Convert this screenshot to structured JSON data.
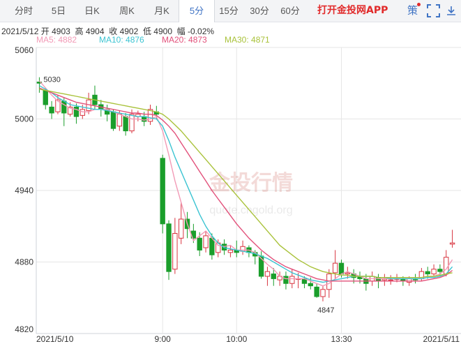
{
  "toolbar": {
    "tabs": [
      "分时",
      "5日",
      "日K",
      "周K",
      "月K",
      "5分",
      "15分",
      "30分",
      "60分"
    ],
    "active_tab": "5分",
    "app_label": "打开金投网APP",
    "extra_label": "策"
  },
  "info_bar": {
    "date": "2021/5/12",
    "open_label": "开",
    "open": "4903",
    "high_label": "高",
    "high": "4904",
    "close_label": "收",
    "close": "4902",
    "low_label": "低",
    "low": "4900",
    "change_label": "幅",
    "change": "-0.02%"
  },
  "legend": [
    {
      "label": "MA5: 4882",
      "color": "#f29ab6"
    },
    {
      "label": "MA10: 4876",
      "color": "#3cc4d2"
    },
    {
      "label": "MA20: 4873",
      "color": "#e2507a"
    },
    {
      "label": "MA30: 4871",
      "color": "#a9c23a"
    }
  ],
  "watermark": {
    "brand": "金投行情",
    "url": "quote.cngold.org"
  },
  "colors": {
    "up": "#d8343f",
    "down": "#1a9e2b",
    "grid": "#e6e6e6",
    "axis_text": "#333333"
  },
  "chart_data": {
    "type": "candlestick",
    "ylim": [
      4820,
      5060
    ],
    "yticks": [
      5060,
      5000,
      4940,
      4880,
      4820
    ],
    "xticks": [
      {
        "label": "2021/5/10",
        "index": 0
      },
      {
        "label": "9:00",
        "index": 20
      },
      {
        "label": "10:00",
        "index": 32
      },
      {
        "label": "13:30",
        "index": 49
      },
      {
        "label": "2021/5/11",
        "index": 67
      }
    ],
    "annotations": [
      {
        "text": "5030",
        "index": 0,
        "value": 5030
      },
      {
        "text": "4847",
        "index": 46,
        "value": 4847
      }
    ],
    "candles": [
      [
        5031,
        5030,
        5035,
        5022
      ],
      [
        5024,
        5012,
        5026,
        5008
      ],
      [
        5010,
        5005,
        5015,
        5000
      ],
      [
        5006,
        5016,
        5020,
        5004
      ],
      [
        5015,
        5005,
        5018,
        4994
      ],
      [
        5004,
        5010,
        5014,
        5002
      ],
      [
        5010,
        5002,
        5013,
        4996
      ],
      [
        5003,
        5008,
        5012,
        5000
      ],
      [
        5007,
        5016,
        5022,
        5004
      ],
      [
        5020,
        5012,
        5028,
        5008
      ],
      [
        5012,
        5008,
        5016,
        5002
      ],
      [
        5008,
        5004,
        5012,
        4998
      ],
      [
        5006,
        4992,
        5008,
        4990
      ],
      [
        4994,
        5004,
        5007,
        4990
      ],
      [
        5002,
        4990,
        5005,
        4986
      ],
      [
        4990,
        5004,
        5008,
        4988
      ],
      [
        5002,
        5004,
        5007,
        4998
      ],
      [
        5002,
        4998,
        5006,
        4994
      ],
      [
        4998,
        5008,
        5012,
        4995
      ],
      [
        5006,
        5004,
        5011,
        5000
      ],
      [
        4967,
        4912,
        4970,
        4904
      ],
      [
        4912,
        4872,
        4915,
        4865
      ],
      [
        4874,
        4904,
        4917,
        4870
      ],
      [
        4900,
        4916,
        4930,
        4895
      ],
      [
        4916,
        4908,
        4922,
        4900
      ],
      [
        4906,
        4900,
        4912,
        4896
      ],
      [
        4900,
        4890,
        4905,
        4885
      ],
      [
        4892,
        4902,
        4906,
        4888
      ],
      [
        4900,
        4886,
        4904,
        4882
      ],
      [
        4888,
        4896,
        4899,
        4884
      ],
      [
        4895,
        4890,
        4899,
        4886
      ],
      [
        4888,
        4890,
        4894,
        4884
      ],
      [
        4890,
        4888,
        4898,
        4884
      ],
      [
        4889,
        4893,
        4898,
        4886
      ],
      [
        4892,
        4888,
        4894,
        4884
      ],
      [
        4888,
        4885,
        4890,
        4878
      ],
      [
        4885,
        4868,
        4889,
        4866
      ],
      [
        4868,
        4872,
        4876,
        4860
      ],
      [
        4870,
        4866,
        4875,
        4860
      ],
      [
        4865,
        4868,
        4872,
        4860
      ],
      [
        4868,
        4862,
        4872,
        4857
      ],
      [
        4862,
        4868,
        4874,
        4858
      ],
      [
        4866,
        4866,
        4871,
        4858
      ],
      [
        4866,
        4862,
        4868,
        4858
      ],
      [
        4862,
        4860,
        4867,
        4857
      ],
      [
        4859,
        4851,
        4862,
        4850
      ],
      [
        4851,
        4857,
        4860,
        4847
      ],
      [
        4857,
        4870,
        4874,
        4850
      ],
      [
        4871,
        4879,
        4890,
        4866
      ],
      [
        4879,
        4870,
        4882,
        4867
      ],
      [
        4870,
        4871,
        4876,
        4866
      ],
      [
        4870,
        4867,
        4874,
        4862
      ],
      [
        4868,
        4866,
        4872,
        4862
      ],
      [
        4866,
        4862,
        4870,
        4856
      ],
      [
        4864,
        4868,
        4872,
        4860
      ],
      [
        4867,
        4864,
        4870,
        4858
      ],
      [
        4865,
        4866,
        4870,
        4860
      ],
      [
        4865,
        4865,
        4869,
        4861
      ],
      [
        4866,
        4866,
        4870,
        4863
      ],
      [
        4866,
        4864,
        4868,
        4860
      ],
      [
        4863,
        4866,
        4868,
        4860
      ],
      [
        4866,
        4865,
        4870,
        4862
      ],
      [
        4866,
        4872,
        4875,
        4864
      ],
      [
        4872,
        4870,
        4876,
        4866
      ],
      [
        4870,
        4874,
        4878,
        4868
      ],
      [
        4874,
        4872,
        4878,
        4868
      ],
      [
        4870,
        4884,
        4890,
        4868
      ],
      [
        4895,
        4896,
        4907,
        4892
      ]
    ],
    "ma_series": [
      {
        "name": "MA5",
        "color": "#f29ab6",
        "values": [
          5032,
          5026,
          5020,
          5015,
          5012,
          5009,
          5008,
          5006,
          5006,
          5008,
          5008,
          5008,
          5006,
          5004,
          5002,
          5000,
          5000,
          4999,
          5000,
          5002,
          4990,
          4970,
          4948,
          4930,
          4912,
          4898,
          4902,
          4906,
          4900,
          4894,
          4893,
          4894,
          4890,
          4890,
          4890,
          4888,
          4883,
          4878,
          4874,
          4868,
          4866,
          4866,
          4866,
          4866,
          4864,
          4862,
          4860,
          4862,
          4866,
          4870,
          4872,
          4870,
          4868,
          4866,
          4866,
          4866,
          4866,
          4866,
          4866,
          4866,
          4866,
          4866,
          4866,
          4867,
          4868,
          4870,
          4874,
          4882
        ]
      },
      {
        "name": "MA10",
        "color": "#3cc4d2",
        "values": [
          5028,
          5025,
          5022,
          5018,
          5015,
          5012,
          5011,
          5010,
          5009,
          5008,
          5008,
          5007,
          5006,
          5005,
          5004,
          5003,
          5002,
          5002,
          5001,
          5000,
          4994,
          4982,
          4968,
          4956,
          4944,
          4932,
          4920,
          4910,
          4902,
          4896,
          4892,
          4891,
          4890,
          4889,
          4888,
          4887,
          4885,
          4883,
          4880,
          4877,
          4874,
          4871,
          4869,
          4867,
          4865,
          4864,
          4863,
          4864,
          4865,
          4866,
          4867,
          4868,
          4868,
          4868,
          4868,
          4867,
          4867,
          4866,
          4866,
          4866,
          4866,
          4866,
          4866,
          4867,
          4867,
          4868,
          4870,
          4876
        ]
      },
      {
        "name": "MA20",
        "color": "#e2507a",
        "values": [
          5026,
          5024,
          5022,
          5020,
          5018,
          5016,
          5014,
          5013,
          5012,
          5011,
          5010,
          5009,
          5008,
          5007,
          5006,
          5005,
          5005,
          5004,
          5004,
          5003,
          4999,
          4994,
          4988,
          4980,
          4972,
          4964,
          4956,
          4948,
          4940,
          4933,
          4926,
          4919,
          4912,
          4906,
          4900,
          4895,
          4890,
          4886,
          4882,
          4879,
          4876,
          4874,
          4872,
          4870,
          4868,
          4866,
          4865,
          4864,
          4864,
          4864,
          4864,
          4864,
          4864,
          4864,
          4864,
          4864,
          4864,
          4864,
          4864,
          4864,
          4864,
          4864,
          4864,
          4865,
          4866,
          4867,
          4869,
          4873
        ]
      },
      {
        "name": "MA30",
        "color": "#a9c23a",
        "values": [
          5025,
          5024,
          5023,
          5022,
          5021,
          5020,
          5019,
          5018,
          5017,
          5016,
          5015,
          5014,
          5013,
          5012,
          5011,
          5010,
          5009,
          5008,
          5007,
          5006,
          5004,
          5000,
          4995,
          4990,
          4984,
          4978,
          4972,
          4966,
          4960,
          4954,
          4948,
          4942,
          4936,
          4930,
          4924,
          4918,
          4912,
          4906,
          4900,
          4894,
          4890,
          4886,
          4882,
          4879,
          4876,
          4874,
          4872,
          4871,
          4870,
          4869,
          4869,
          4868,
          4868,
          4868,
          4868,
          4867,
          4867,
          4867,
          4867,
          4867,
          4867,
          4867,
          4867,
          4868,
          4868,
          4869,
          4870,
          4871
        ]
      }
    ]
  }
}
